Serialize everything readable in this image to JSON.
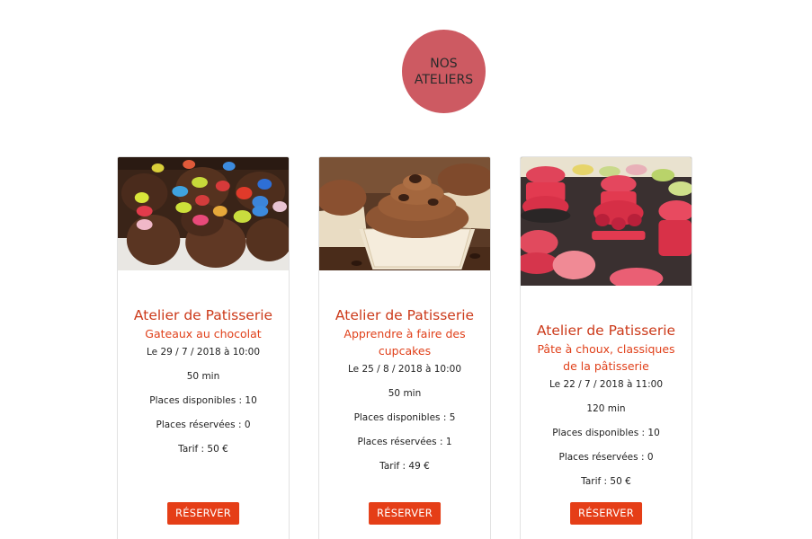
{
  "header": {
    "badge_line1": "NOS",
    "badge_line2": "ATELIERS"
  },
  "workshops": [
    {
      "title": "Atelier de Patisserie",
      "subtitle": "Gateaux au chocolat",
      "date": "Le 29 / 7 / 2018 à 10:00",
      "duration": "50 min",
      "places_available": "Places disponibles : 10",
      "places_reserved": "Places réservées : 0",
      "price": "Tarif : 50 €",
      "button_label": "RÉSERVER",
      "image": "chocolate-cakes-with-candies"
    },
    {
      "title": "Atelier de Patisserie",
      "subtitle": "Apprendre à faire des cupcakes",
      "date": "Le 25 / 8 / 2018 à 10:00",
      "duration": "50 min",
      "places_available": "Places disponibles : 5",
      "places_reserved": "Places réservées : 1",
      "price": "Tarif : 49 €",
      "button_label": "RÉSERVER",
      "image": "chocolate-cupcakes"
    },
    {
      "title": "Atelier de Patisserie",
      "subtitle": "Pâte à choux, classiques de la pâtisserie",
      "date": "Le 22 / 7 / 2018 à 11:00",
      "duration": "120 min",
      "places_available": "Places disponibles : 10",
      "places_reserved": "Places réservées : 0",
      "price": "Tarif : 50 €",
      "button_label": "RÉSERVER",
      "image": "raspberry-macarons"
    }
  ],
  "colors": {
    "badge": "#cd5a62",
    "title": "#cc3a1a",
    "subtitle": "#e0401a",
    "button": "#e53e17"
  }
}
